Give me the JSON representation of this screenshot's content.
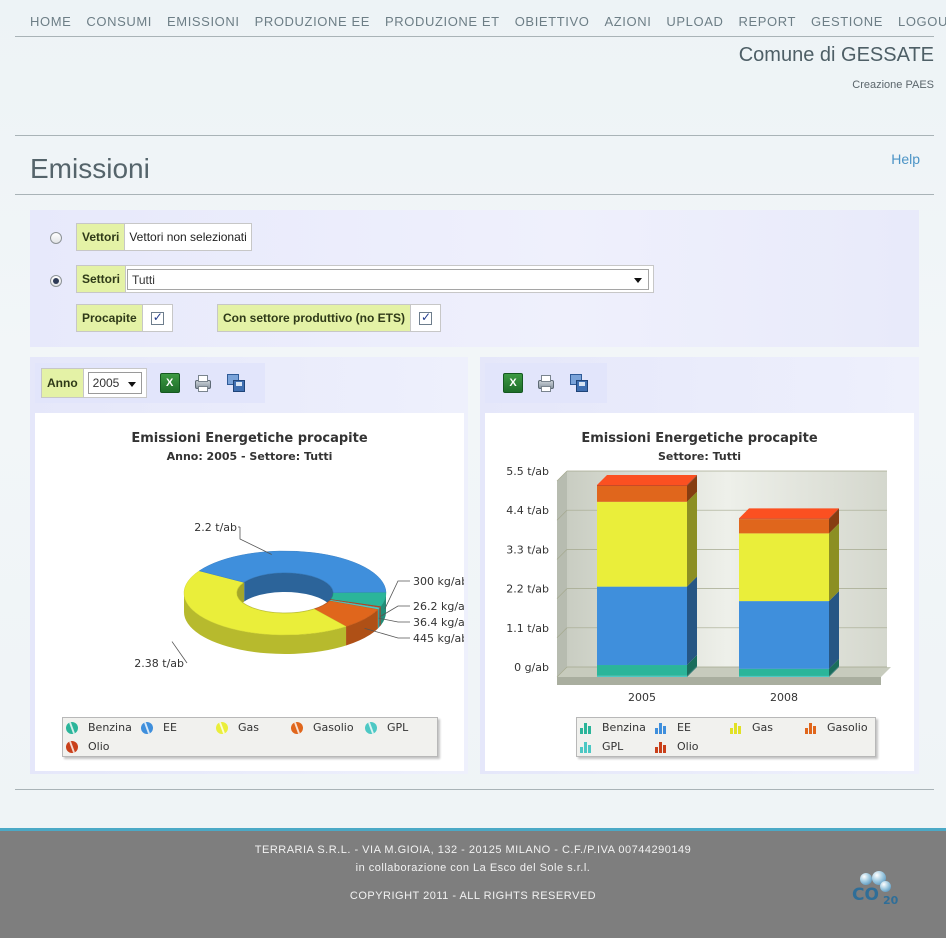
{
  "nav": [
    "HOME",
    "CONSUMI",
    "EMISSIONI",
    "PRODUZIONE EE",
    "PRODUZIONE ET",
    "OBIETTIVO",
    "AZIONI",
    "UPLOAD",
    "REPORT",
    "GESTIONE",
    "LOGOUT"
  ],
  "header": {
    "comune": "Comune di GESSATE",
    "subtitle": "Creazione PAES"
  },
  "page": {
    "title": "Emissioni",
    "help": "Help"
  },
  "filter": {
    "vettori_label": "Vettori",
    "vettori_value": "Vettori non selezionati",
    "settori_label": "Settori",
    "settori_value": "Tutti",
    "procapite_label": "Procapite",
    "procapite_checked": true,
    "settore_produttivo_label": "Con settore produttivo (no ETS)",
    "settore_produttivo_checked": true,
    "selected_radio": "settori"
  },
  "left_panel": {
    "anno_label": "Anno",
    "anno_value": "2005",
    "icons": [
      "excel-icon",
      "print-icon",
      "save-icon"
    ]
  },
  "right_panel": {
    "icons": [
      "excel-icon",
      "print-icon",
      "save-icon"
    ]
  },
  "colors": {
    "Benzina": "#2bb59a",
    "EE": "#3f8fdc",
    "Gas": "#eaee3a",
    "Gasolio": "#e0661c",
    "GPL": "#4dc8c4",
    "Olio": "#c9401a"
  },
  "chart_data": [
    {
      "type": "pie",
      "title": "Emissioni Energetiche procapite",
      "subtitle": "Anno: 2005 - Settore: Tutti",
      "slices": [
        {
          "name": "Benzina",
          "label": "300 kg/ab",
          "value": 0.3
        },
        {
          "name": "Olio",
          "label": "26.2 kg/ab",
          "value": 0.0262
        },
        {
          "name": "GPL",
          "label": "36.4 kg/ab",
          "value": 0.0364
        },
        {
          "name": "Gasolio",
          "label": "445 kg/ab",
          "value": 0.445
        },
        {
          "name": "Gas",
          "label": "2.38 t/ab",
          "value": 2.38
        },
        {
          "name": "EE",
          "label": "2.2 t/ab",
          "value": 2.2
        }
      ],
      "legend": [
        "Benzina",
        "EE",
        "Gas",
        "Gasolio",
        "GPL",
        "Olio"
      ]
    },
    {
      "type": "bar",
      "title": "Emissioni Energetiche procapite",
      "subtitle": "Settore: Tutti",
      "categories": [
        "2005",
        "2008"
      ],
      "ylim": [
        0,
        5.5
      ],
      "yticks": [
        "0 g/ab",
        "1.1 t/ab",
        "2.2 t/ab",
        "3.3 t/ab",
        "4.4 t/ab",
        "5.5 t/ab"
      ],
      "series": [
        {
          "name": "Benzina",
          "values": [
            0.3,
            0.2
          ]
        },
        {
          "name": "EE",
          "values": [
            2.2,
            1.9
          ]
        },
        {
          "name": "Gas",
          "values": [
            2.38,
            1.9
          ]
        },
        {
          "name": "Gasolio",
          "values": [
            0.445,
            0.4
          ]
        },
        {
          "name": "GPL",
          "values": [
            0.036,
            0.03
          ]
        },
        {
          "name": "Olio",
          "values": [
            0.026,
            0.02
          ]
        }
      ],
      "legend": [
        "Benzina",
        "EE",
        "Gas",
        "Gasolio",
        "GPL",
        "Olio"
      ]
    }
  ],
  "footer": {
    "line1": "TERRARIA S.R.L. - VIA M.GIOIA, 132 - 20125 MILANO - C.F./P.IVA 00744290149",
    "line2": "in collaborazione con La Esco del Sole s.r.l.",
    "line3": "COPYRIGHT 2011 - ALL RIGHTS RESERVED",
    "logo_text": "CO",
    "logo_sub": "20"
  }
}
